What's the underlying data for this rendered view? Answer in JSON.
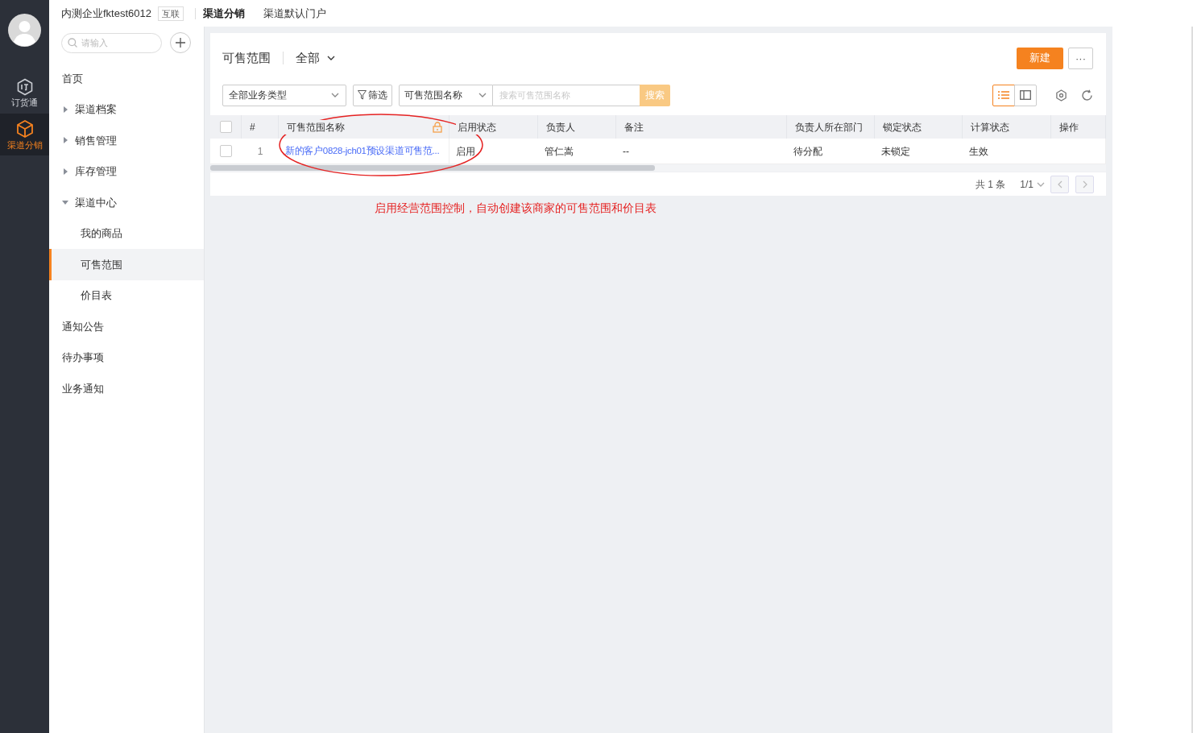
{
  "rail": {
    "items": [
      {
        "label": "订货通",
        "kind": "order",
        "selected": false
      },
      {
        "label": "渠道分销",
        "kind": "cube",
        "selected": true
      }
    ]
  },
  "header": {
    "company": "内测企业fktest6012",
    "badge": "互联",
    "tabs": [
      {
        "label": "渠道分销",
        "selected": true
      },
      {
        "label": "渠道默认门户",
        "selected": false
      }
    ]
  },
  "sidebar": {
    "search": {
      "placeholder": "请输入"
    },
    "items": [
      {
        "label": "首页",
        "selected": false
      },
      {
        "label": "渠道档案",
        "selected": false,
        "expanded": false
      },
      {
        "label": "销售管理",
        "selected": false,
        "expanded": false
      },
      {
        "label": "库存管理",
        "selected": false,
        "expanded": false
      },
      {
        "label": "渠道中心",
        "selected": false,
        "expanded": true,
        "children": [
          {
            "label": "我的商品",
            "selected": false
          },
          {
            "label": "可售范围",
            "selected": true
          },
          {
            "label": "价目表",
            "selected": false
          }
        ]
      },
      {
        "label": "通知公告",
        "selected": false
      },
      {
        "label": "待办事项",
        "selected": false
      },
      {
        "label": "业务通知",
        "selected": false
      }
    ]
  },
  "page": {
    "title": "可售范围",
    "scope": "全部",
    "new_button": "新建",
    "more_button": "···",
    "type_select": "全部业务类型",
    "filter_button": "筛选",
    "field_select": "可售范围名称",
    "search": {
      "placeholder": "搜索可售范围名称"
    },
    "search_button": "搜索",
    "views": [
      {
        "kind": "list",
        "selected": true
      },
      {
        "kind": "split",
        "selected": false
      }
    ]
  },
  "table": {
    "select_all_checked": false,
    "columns": [
      "#",
      "可售范围名称",
      "启用状态",
      "负责人",
      "备注",
      "负责人所在部门",
      "锁定状态",
      "计算状态",
      "操作"
    ],
    "rows": [
      {
        "checked": false,
        "cells": [
          "1",
          "新的客户0828-jch01预设渠道可售范...",
          "启用",
          "管仁嵩",
          "--",
          "待分配",
          "未锁定",
          "生效",
          ""
        ]
      }
    ]
  },
  "pagination": {
    "total": "共 1 条",
    "page": "1/1"
  },
  "annotation": "启用经营范围控制，自动创建该商家的可售范围和价目表"
}
